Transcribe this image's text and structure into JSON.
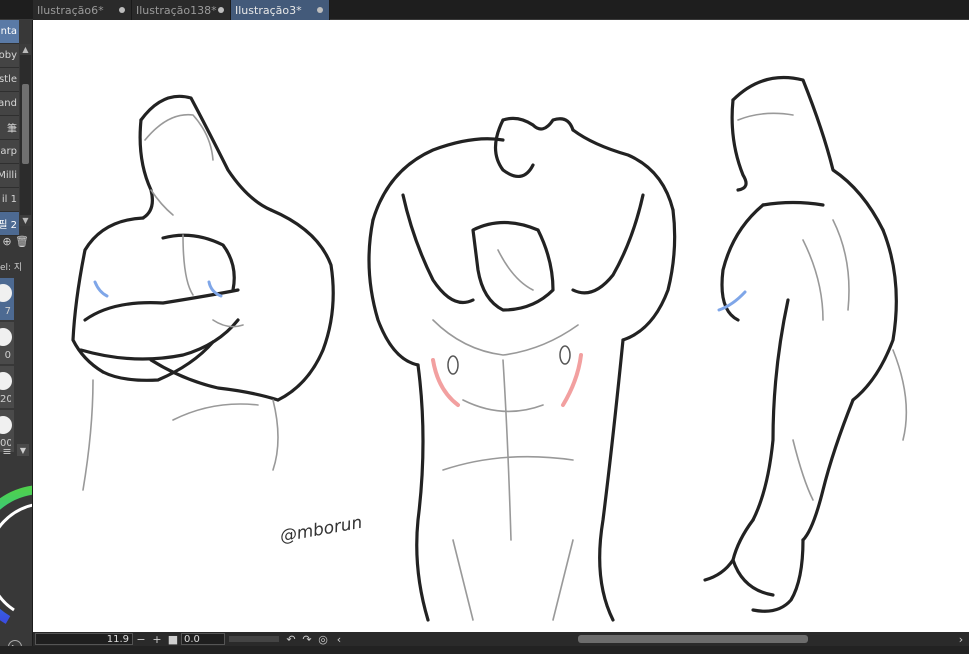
{
  "tabs": [
    {
      "label": "Ilustração6*",
      "active": false
    },
    {
      "label": "Ilustração138*",
      "active": false
    },
    {
      "label": "Ilustração3*",
      "active": true
    }
  ],
  "brush_list": [
    "Tinta",
    "oby",
    "stle",
    "and",
    "筆",
    "arp",
    "Milli",
    "il 1",
    "필 2"
  ],
  "brush_size_header": "el: 지",
  "brush_sizes": [
    "7",
    "0",
    "20",
    "00"
  ],
  "bottom": {
    "zoom": "11.9",
    "angle": "0.0",
    "minus": "−",
    "plus": "+"
  },
  "canvas": {
    "signature": "@mborun"
  },
  "colors": {
    "accent_tab": "#435a7a",
    "canvas": "#ffffff",
    "panel": "#383838",
    "shadow_blue": "#7fa6e8",
    "shadow_red": "#f2a0a0"
  },
  "icons": [
    "add-icon",
    "trash-icon",
    "play-icon",
    "rotate-left-icon",
    "rotate-right-icon",
    "reset-rotation-icon",
    "chevron-left-icon",
    "chevron-right-icon"
  ]
}
